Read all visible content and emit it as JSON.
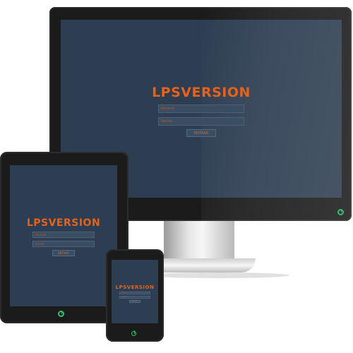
{
  "brand": {
    "title": "LPSVERSION",
    "accent_color": "#e5621a",
    "screen_color": "#2e3e52"
  },
  "login": {
    "username_placeholder": "Usuario",
    "password_placeholder": "Senha",
    "submit_label": "ENTRAR"
  },
  "icons": {
    "power": "power-icon"
  }
}
